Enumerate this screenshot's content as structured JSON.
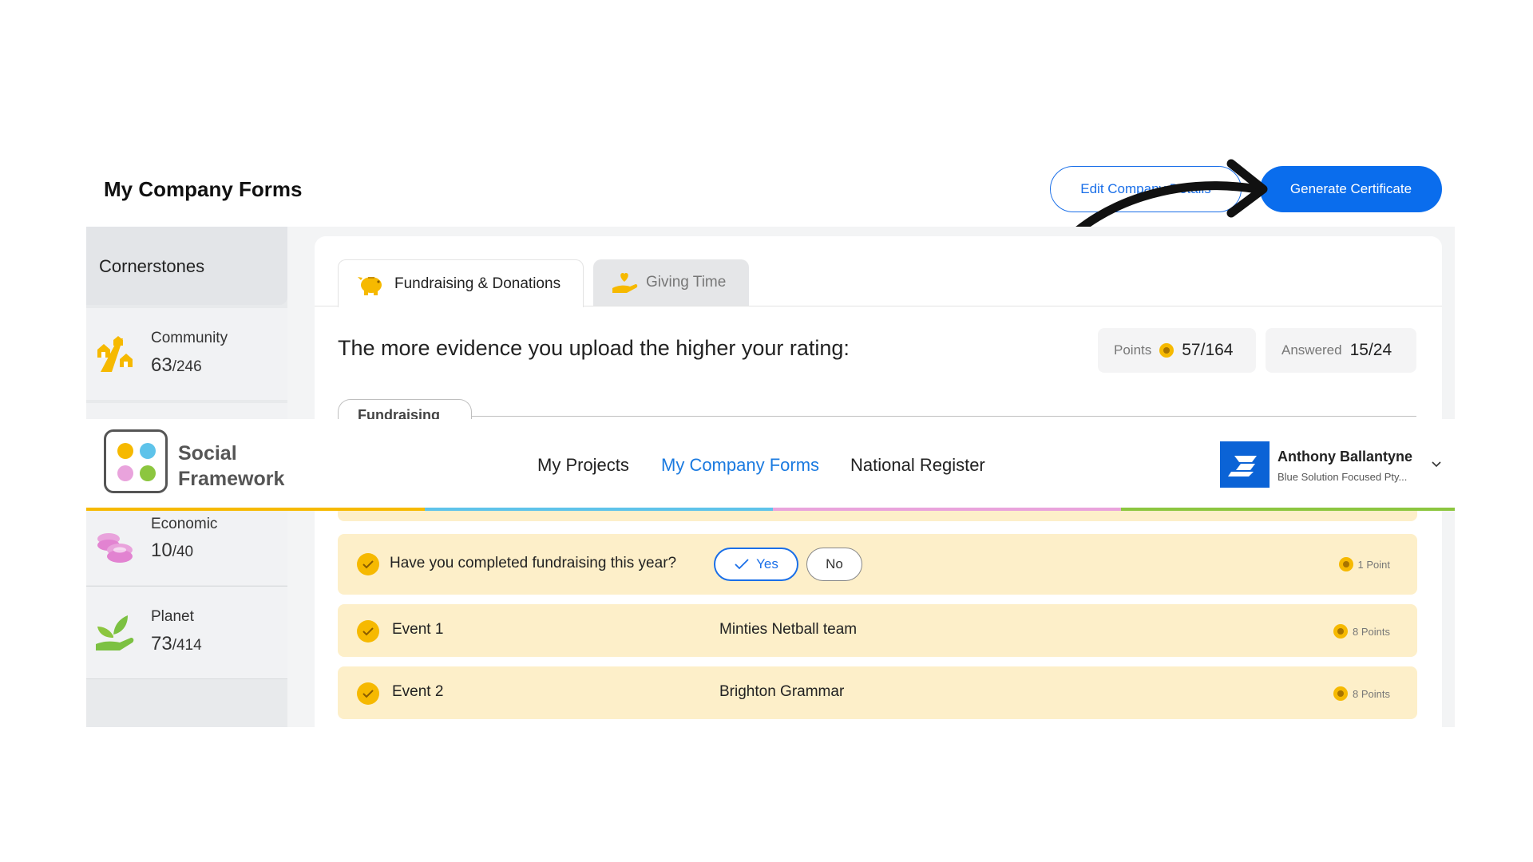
{
  "header": {
    "title": "My Company Forms",
    "edit_button": "Edit Company Details",
    "generate_button": "Generate Certificate"
  },
  "sidebar": {
    "heading": "Cornerstones",
    "items": [
      {
        "label": "Community",
        "score": "63",
        "total": "/246",
        "icon": "houses-road-icon"
      },
      {
        "label": "Economic",
        "score": "10",
        "total": "/40",
        "icon": "coins-icon"
      },
      {
        "label": "Planet",
        "score": "73",
        "total": "/414",
        "icon": "plant-hand-icon"
      }
    ]
  },
  "tabs": [
    {
      "label": "Fundraising & Donations",
      "icon": "piggy-bank-icon",
      "active": true
    },
    {
      "label": "Giving Time",
      "icon": "hand-heart-icon",
      "active": false
    }
  ],
  "main": {
    "prompt": "The more evidence you upload the higher your rating:",
    "points_label": "Points",
    "points_value": "57/164",
    "answered_label": "Answered",
    "answered_value": "15/24",
    "sub_tab": "Fundraising"
  },
  "navbar": {
    "logo_line1": "Social",
    "logo_line2": "Framework",
    "links": [
      "My Projects",
      "My Company Forms",
      "National Register"
    ],
    "active_link": "My Company Forms",
    "user_name": "Anthony Ballantyne",
    "user_org": "Blue Solution Focused Pty...",
    "rainbow_colors": [
      "#f6b900",
      "#5ec3ea",
      "#e9a3dc",
      "#8cc63f"
    ]
  },
  "rows": [
    {
      "question": "Have you completed fundraising this year?",
      "yes": "Yes",
      "no": "No",
      "points": "1 Point"
    },
    {
      "label": "Event 1",
      "value": "Minties Netball team",
      "points": "8 Points"
    },
    {
      "label": "Event 2",
      "value": "Brighton Grammar",
      "points": "8 Points"
    }
  ],
  "colors": {
    "accent": "#0a6ded",
    "row_bg": "#fdefc9",
    "coin": "#f6b900"
  }
}
